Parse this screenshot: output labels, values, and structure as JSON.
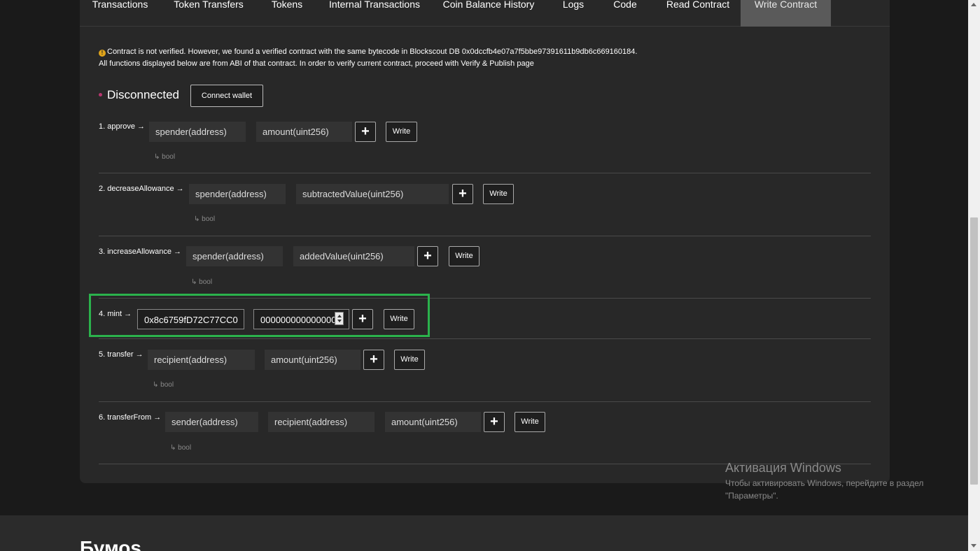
{
  "tabs": [
    {
      "label": "Transactions"
    },
    {
      "label": "Token Transfers"
    },
    {
      "label": "Tokens"
    },
    {
      "label": "Internal Transactions"
    },
    {
      "label": "Coin Balance History"
    },
    {
      "label": "Logs"
    },
    {
      "label": "Code"
    },
    {
      "label": "Read Contract"
    },
    {
      "label": "Write Contract"
    }
  ],
  "notice": {
    "icon": "warning-icon",
    "line1": "Contract is not verified. However, we found a verified contract with the same bytecode in Blockscout DB 0x0dccfb4e07a7f5bbe97391611b9db6c669160184.",
    "line2": "All functions displayed below are from ABI of that contract. In order to verify current contract, proceed with Verify & Publish page"
  },
  "wallet": {
    "status": "Disconnected",
    "status_color": "#b8366e",
    "connect_label": "Connect wallet"
  },
  "functions": [
    {
      "label": "1. approve →",
      "inputs": [
        "spender(address)",
        "amount(uint256)"
      ],
      "returns": "↳ bool"
    },
    {
      "label": "2. decreaseAllowance →",
      "inputs": [
        "spender(address)",
        "subtractedValue(uint256)"
      ],
      "returns": "↳ bool"
    },
    {
      "label": "3. increaseAllowance →",
      "inputs": [
        "spender(address)",
        "addedValue(uint256)"
      ],
      "returns": "↳ bool"
    },
    {
      "label": "4. mint →",
      "values": [
        "0x8c6759fD72C77CC0",
        "000000000000000"
      ]
    },
    {
      "label": "5. transfer →",
      "inputs": [
        "recipient(address)",
        "amount(uint256)"
      ],
      "returns": "↳ bool"
    },
    {
      "label": "6. transferFrom →",
      "inputs": [
        "sender(address)",
        "recipient(address)",
        "amount(uint256)"
      ],
      "returns": "↳ bool"
    }
  ],
  "buttons": {
    "plus": "+",
    "write": "Write"
  },
  "highlight_color": "#2bb24c",
  "footer": {
    "title": "Бумоs"
  },
  "watermark": {
    "title": "Активация Windows",
    "line1": "Чтобы активировать Windows, перейдите в раздел",
    "line2": "\"Параметры\"."
  }
}
